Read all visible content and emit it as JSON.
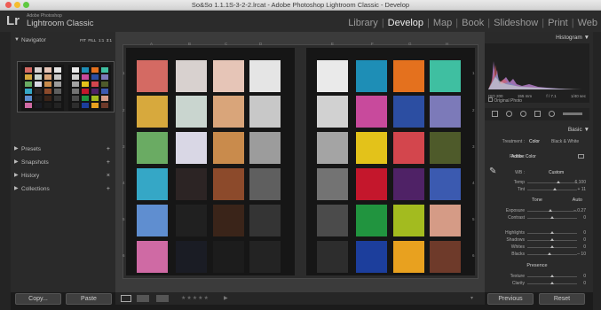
{
  "window": {
    "title": "So&So 1.1.1S-3-2-2.lrcat - Adobe Photoshop Lightroom Classic - Develop"
  },
  "identity": {
    "logo": "Lr",
    "vendor": "Adobe Photoshop",
    "product": "Lightroom Classic"
  },
  "modules": [
    "Library",
    "Develop",
    "Map",
    "Book",
    "Slideshow",
    "Print",
    "Web"
  ],
  "active_module": "Develop",
  "left_panel": {
    "navigator": {
      "title": "Navigator",
      "options": [
        "FIT",
        "FILL",
        "1:1",
        "3:1"
      ]
    },
    "sections": [
      {
        "label": "Presets",
        "action": "+"
      },
      {
        "label": "Snapshots",
        "action": "+"
      },
      {
        "label": "History",
        "action": "×"
      },
      {
        "label": "Collections",
        "action": "+"
      }
    ],
    "copy_button": "Copy...",
    "paste_button": "Paste"
  },
  "colors": {
    "left_page": [
      [
        "#d46a63",
        "#d8d1cf",
        "#e6c5b7",
        "#e5e5e5"
      ],
      [
        "#d7a93d",
        "#c9d5cf",
        "#d9a57a",
        "#c8c8c8"
      ],
      [
        "#6aab63",
        "#d9d7e5",
        "#c98b4c",
        "#9c9c9c"
      ],
      [
        "#35a7c6",
        "#2c2424",
        "#8c4a2b",
        "#5f5f5f"
      ],
      [
        "#5f8ed0",
        "#202020",
        "#3a2419",
        "#343434"
      ],
      [
        "#cf6aa4",
        "#1a1c24",
        "#1c1c1c",
        "#232323"
      ]
    ],
    "right_page": [
      [
        "#eaeaea",
        "#1e8eb6",
        "#e4711e",
        "#3fbfa1"
      ],
      [
        "#d1d1d1",
        "#c84a9c",
        "#2c4ea2",
        "#7c7ab9"
      ],
      [
        "#a4a4a4",
        "#e3c21a",
        "#d3464d",
        "#4e5a2a"
      ],
      [
        "#737373",
        "#c4172c",
        "#4f2266",
        "#3b5ab0"
      ],
      [
        "#4b4b4b",
        "#21943f",
        "#a3bb1f",
        "#d59b86"
      ],
      [
        "#2d2d2d",
        "#1c3e9c",
        "#e8a11f",
        "#6e3a2a"
      ]
    ],
    "left_letters": [
      "A",
      "B",
      "C",
      "D"
    ],
    "right_letters": [
      "E",
      "F",
      "G",
      "H"
    ],
    "row_numbers": [
      "1",
      "2",
      "3",
      "4",
      "5",
      "6"
    ]
  },
  "toolbar": {
    "rating": "★★★★★"
  },
  "right_panel": {
    "histogram": {
      "title": "Histogram",
      "info": [
        "ISO 200",
        "155 mm",
        "f / 7.1",
        "1/40 sec"
      ],
      "original_photo": "Original Photo"
    },
    "basic": {
      "title": "Basic",
      "treatment_label": "Treatment :",
      "treatment_options": [
        "Color",
        "Black & White"
      ],
      "profile_label": "Profile :",
      "profile_value": "Adobe Color",
      "wb_label": "WB :",
      "wb_value": "Custom",
      "temp": {
        "label": "Temp",
        "value": "6,100",
        "pos": 0.62
      },
      "tint": {
        "label": "Tint",
        "value": "+ 11",
        "pos": 0.56
      },
      "tone_label": "Tone",
      "auto_label": "Auto",
      "exposure": {
        "label": "Exposure",
        "value": "– 0.27",
        "pos": 0.47
      },
      "contrast": {
        "label": "Contrast",
        "value": "0",
        "pos": 0.5
      },
      "highlights": {
        "label": "Highlights",
        "value": "0",
        "pos": 0.5
      },
      "shadows": {
        "label": "Shadows",
        "value": "0",
        "pos": 0.5
      },
      "whites": {
        "label": "Whites",
        "value": "0",
        "pos": 0.5
      },
      "blacks": {
        "label": "Blacks",
        "value": "– 10",
        "pos": 0.45
      },
      "presence_label": "Presence",
      "texture": {
        "label": "Texture",
        "value": "0",
        "pos": 0.5
      },
      "clarity": {
        "label": "Clarity",
        "value": "0",
        "pos": 0.5
      }
    },
    "previous_button": "Previous",
    "reset_button": "Reset"
  }
}
